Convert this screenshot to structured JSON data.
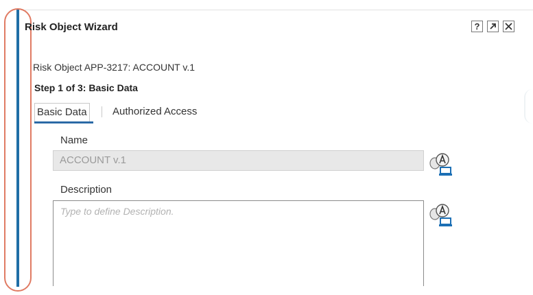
{
  "dialog": {
    "title": "Risk Object Wizard",
    "buttons": {
      "help_label": "?",
      "popout_icon": "popout-icon",
      "close_icon": "close-icon"
    }
  },
  "object_line": "Risk Object APP-3217: ACCOUNT v.1",
  "step_line": "Step 1 of 3: Basic Data",
  "tabs": [
    {
      "label": "Basic Data",
      "active": true
    },
    {
      "label": "Authorized Access",
      "active": false
    }
  ],
  "fields": {
    "name": {
      "label": "Name",
      "value": "ACCOUNT v.1",
      "translate_icon": "translation-icon"
    },
    "description": {
      "label": "Description",
      "value": "",
      "placeholder": "Type to define Description.",
      "translate_icon": "translation-icon"
    }
  },
  "colors": {
    "accent": "#2b6aa6",
    "highlight": "#e07a62",
    "disabled_input": "#e8e8e8"
  }
}
